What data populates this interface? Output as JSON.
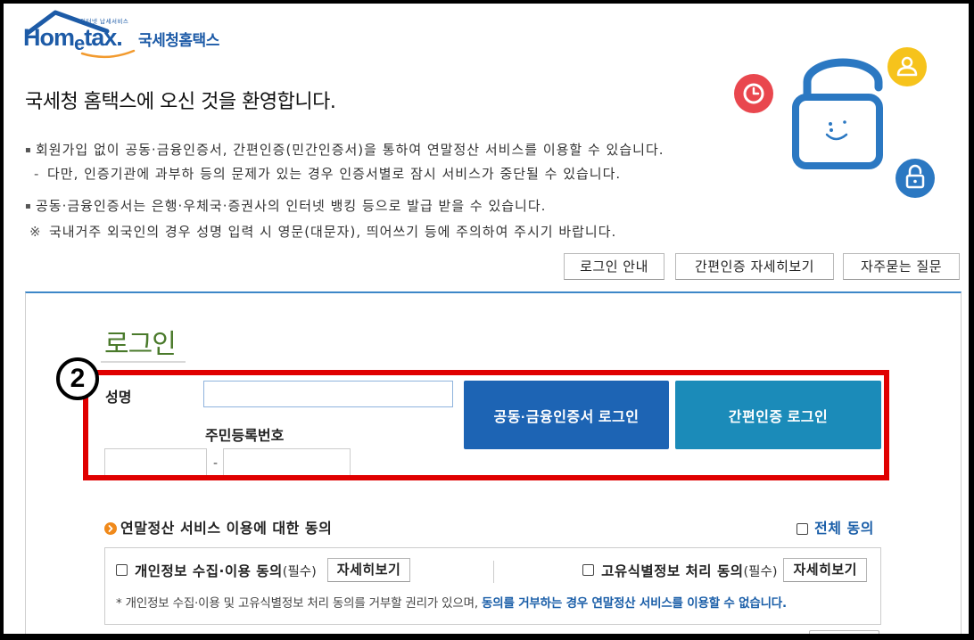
{
  "logo": {
    "tagline": "인터넷 납세서비스",
    "wordmark": {
      "hom": "Hom",
      "e": "e",
      "tax": "tax."
    },
    "service_name": "국세청홈택스"
  },
  "welcome": {
    "title": "국세청 홈택스에 오신 것을 환영합니다.",
    "notices": [
      {
        "marker": "▪",
        "text": "회원가입 없이 공동·금융인증서, 간편인증(민간인증서)을 통하여 연말정산 서비스를 이용할 수 있습니다."
      },
      {
        "marker": "-",
        "text": "다만, 인증기관에 과부하 등의 문제가 있는 경우 인증서별로 잠시 서비스가 중단될 수 있습니다."
      },
      {
        "marker": "▪",
        "text": "공동·금융인증서는 은행·우체국·증권사의 인터넷 뱅킹 등으로 발급 받을 수 있습니다."
      },
      {
        "marker": "※",
        "text": "국내거주 외국인의 경우 성명 입력 시 영문(대문자), 띄어쓰기 등에 주의하여 주시기 바랍니다."
      }
    ]
  },
  "help_links": {
    "login_guide": "로그인 안내",
    "simple_auth_detail": "간편인증 자세히보기",
    "faq": "자주묻는 질문"
  },
  "icons": {
    "logo": "house-roof-icon",
    "illustration": [
      "clock-icon",
      "user-icon",
      "open-padlock-icon",
      "lock-icon"
    ],
    "consent_title": "chevron-circle-icon"
  },
  "login": {
    "title": "로그인",
    "annotation_number": "2",
    "name_field": {
      "label": "성명",
      "value": ""
    },
    "rrn_field": {
      "label": "주민등록번호",
      "front_value": "",
      "separator": "-",
      "back_value": ""
    },
    "cert_login_button": "공동·금융인증서 로그인",
    "simple_auth_login_button": "간편인증 로그인"
  },
  "consent": {
    "title": "연말정산 서비스 이용에 대한 동의",
    "agree_all": {
      "label": "전체 동의",
      "checked": false
    },
    "items": [
      {
        "label": "개인정보 수집·이용 동의",
        "required": "(필수)",
        "detail_button": "자세히보기",
        "checked": false
      },
      {
        "label": "고유식별정보 처리 동의",
        "required": "(필수)",
        "detail_button": "자세히보기",
        "checked": false
      }
    ],
    "notice": {
      "text": "* 개인정보 수집·이용 및 고유식별정보 처리 동의를 거부할 권리가 있으며,",
      "emphasis": "동의를 거부하는 경우 연말정산 서비스를 이용할 수 없습니다."
    }
  },
  "colors": {
    "brand_blue": "#1d5ba7",
    "logo_swoosh_orange": "#f29a2e",
    "panel_line_blue": "#3d87c8",
    "login_title_green": "#4a7a2b",
    "annotation_red": "#e00000",
    "cert_login_button": "#1d64b4",
    "simple_auth_login_button": "#1b8bb9",
    "clock_badge_red": "#e9474e",
    "user_badge_yellow": "#f6c31c",
    "padlock_blue": "#2b78c2",
    "consent_icon_orange": "#f0891a",
    "emphasis_blue": "#1a5ea8"
  }
}
